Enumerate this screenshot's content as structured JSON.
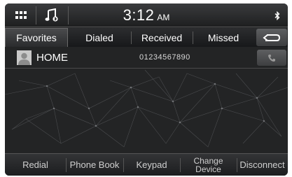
{
  "status": {
    "time": "3:12",
    "ampm": "AM"
  },
  "icons": {
    "apps": "grid-icon",
    "music": "music-note-icon",
    "bluetooth": "bluetooth-icon",
    "back": "back-arrow-icon",
    "phone": "phone-icon",
    "avatar": "contact-avatar-icon"
  },
  "tabs": [
    {
      "label": "Favorites",
      "active": true
    },
    {
      "label": "Dialed"
    },
    {
      "label": "Received"
    },
    {
      "label": "Missed"
    }
  ],
  "favorites": [
    {
      "name": "HOME",
      "number": "01234567890"
    }
  ],
  "bottom": {
    "redial": "Redial",
    "phone_book": "Phone Book",
    "keypad": "Keypad",
    "change_device_line1": "Change",
    "change_device_line2": "Device",
    "disconnect": "Disconnect"
  }
}
